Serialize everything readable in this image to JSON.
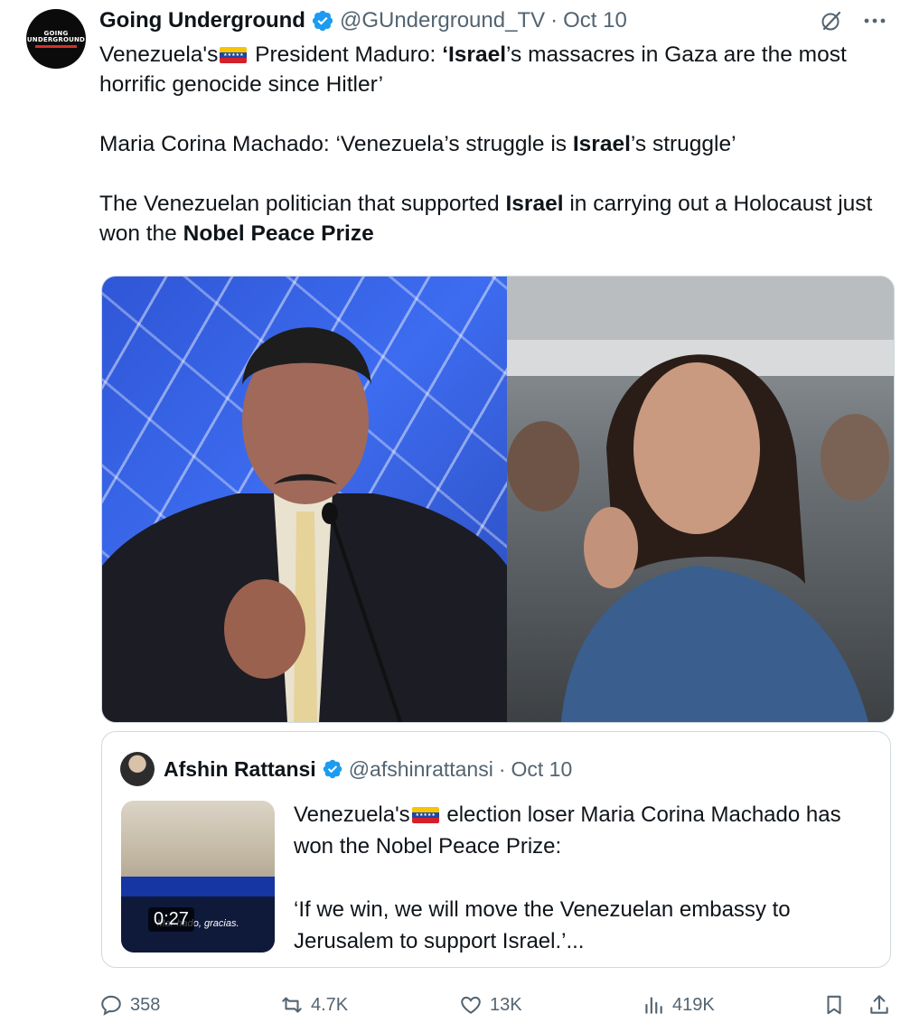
{
  "author": {
    "avatar_text": "GOING\nUNDERGROUND",
    "name": "Going Underground",
    "handle": "@GUnderground_TV",
    "separator": "·",
    "date": "Oct 10"
  },
  "tweet": {
    "paragraph1": {
      "a": "Venezuela's",
      "flag": "venezuela-flag",
      "b": " President Maduro: ",
      "c_bold": "‘Israel",
      "d": "’s massacres in Gaza are the most horrific genocide since Hitler’"
    },
    "paragraph2": {
      "a": "Maria Corina Machado: ‘Venezuela’s struggle is ",
      "b_bold": "Israel",
      "c": "’s struggle’"
    },
    "paragraph3": {
      "a": "The Venezuelan politician that supported ",
      "b_bold": "Israel",
      "c": " in carrying out a Holocaust just won the ",
      "d_bold": "Nobel Peace Prize"
    }
  },
  "media": {
    "left_photo": "Nicolás Maduro speaking at podium",
    "right_photo": "Maria Corina Machado in crowd"
  },
  "quote": {
    "name": "Afshin Rattansi",
    "handle": "@afshinrattansi",
    "separator": "·",
    "date": "Oct 10",
    "video_duration": "0:27",
    "video_caption": "Mar         hado, gracias.",
    "paragraph1_a": "Venezuela's",
    "paragraph1_b": " election loser Maria Corina Machado has won the Nobel Peace Prize:",
    "paragraph2": "‘If we win, we will move the Venezuelan embassy to Jerusalem to support Israel.’..."
  },
  "actions": {
    "replies": "358",
    "reposts": "4.7K",
    "likes": "13K",
    "views": "419K"
  },
  "colors": {
    "text": "#0f1419",
    "secondary": "#536471",
    "verified": "#1d9bf0",
    "border": "#cfd9de"
  }
}
